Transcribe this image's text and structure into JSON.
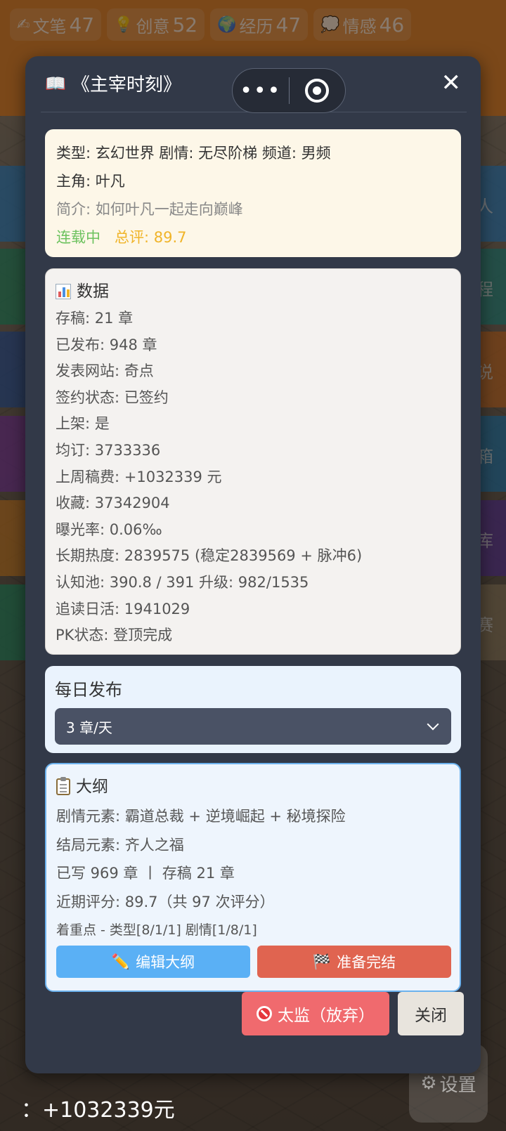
{
  "background": {
    "stats": [
      {
        "icon": "✍",
        "label": "文笔",
        "value": "47"
      },
      {
        "icon": "💡",
        "label": "创意",
        "value": "52"
      },
      {
        "icon": "🌍",
        "label": "经历",
        "value": "47"
      },
      {
        "icon": "💭",
        "label": "情感",
        "value": "46"
      }
    ],
    "side_labels": [
      "人",
      "程",
      "说",
      "箱",
      "库",
      "赛"
    ],
    "footer_text": "：+1032339元",
    "settings_label": "设置"
  },
  "modal": {
    "title": "《主宰时刻》",
    "capsule": {
      "more": "•••"
    },
    "close": "✕",
    "info": {
      "line1": "类型: 玄幻世界  剧情: 无尽阶梯  频道: 男频",
      "protagonist": "主角: 叶凡",
      "summary": "简介: 如何叶凡一起走向巅峰",
      "status": "连载中",
      "rating": "总评: 89.7"
    },
    "data": {
      "header": "数据",
      "lines": [
        "存稿: 21 章",
        "已发布: 948 章",
        "发表网站: 奇点",
        "签约状态: 已签约",
        "上架: 是",
        "均订: 3733336",
        "上周稿费: +1032339 元",
        "收藏: 37342904",
        "曝光率: 0.06‰",
        "长期热度: 2839575 (稳定2839569 + 脉冲6)",
        "认知池: 390.8 / 391  升级: 982/1535",
        "追读日活: 1941029",
        "PK状态: 登顶完成"
      ]
    },
    "daily": {
      "label": "每日发布",
      "selected": "3 章/天"
    },
    "outline": {
      "header": "大纲",
      "plot_elements": "剧情元素: 霸道总裁 + 逆境崛起 + 秘境探险",
      "ending_elements": "结局元素: 齐人之福",
      "progress": "已写 969 章 丨 存稿 21 章",
      "recent_score": "近期评分: 89.7（共 97 次评分）",
      "focus": "着重点 - 类型[8/1/1] 剧情[1/8/1]",
      "edit_button": "编辑大纲",
      "finish_button": "准备完结"
    },
    "footer": {
      "abandon_button": "太监（放弃）",
      "close_button": "关闭"
    }
  },
  "colors": {
    "green": "#6cc25e",
    "gold": "#f0b429",
    "edit": "#5ab0f5",
    "finish": "#e06450",
    "abandon": "#f06a6e"
  }
}
